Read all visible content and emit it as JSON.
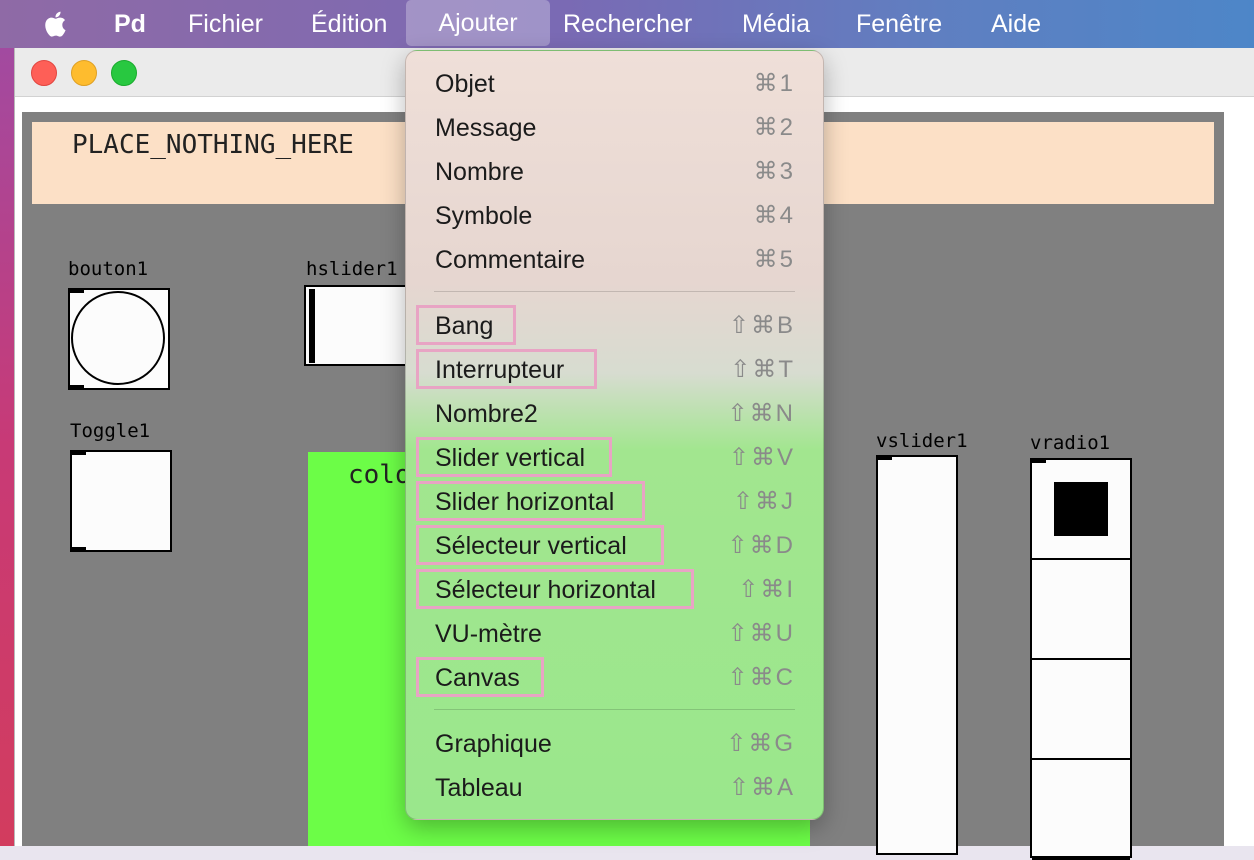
{
  "menubar": {
    "app": "Pd",
    "items": [
      "Fichier",
      "Édition",
      "Ajouter",
      "Rechercher",
      "Média",
      "Fenêtre",
      "Aide"
    ],
    "active": "Ajouter"
  },
  "patch": {
    "banner_text": "PLACE_NOTHING_HERE",
    "labels": {
      "bouton1": "bouton1",
      "hslider1": "hslider1",
      "toggle1": "Toggle1",
      "vslider1": "vslider1",
      "vradio1": "vradio1",
      "canvas_partial": "colo"
    },
    "vradio_selected_index": 0
  },
  "menu": {
    "group1": [
      {
        "label": "Objet",
        "shortcut": "⌘1"
      },
      {
        "label": "Message",
        "shortcut": "⌘2"
      },
      {
        "label": "Nombre",
        "shortcut": "⌘3"
      },
      {
        "label": "Symbole",
        "shortcut": "⌘4"
      },
      {
        "label": "Commentaire",
        "shortcut": "⌘5"
      }
    ],
    "group2": [
      {
        "label": "Bang",
        "shortcut": "⇧⌘B"
      },
      {
        "label": "Interrupteur",
        "shortcut": "⇧⌘T"
      },
      {
        "label": "Nombre2",
        "shortcut": "⇧⌘N"
      },
      {
        "label": "Slider vertical",
        "shortcut": "⇧⌘V"
      },
      {
        "label": "Slider horizontal",
        "shortcut": "⇧⌘J"
      },
      {
        "label": "Sélecteur vertical",
        "shortcut": "⇧⌘D"
      },
      {
        "label": "Sélecteur horizontal",
        "shortcut": "⇧⌘I"
      },
      {
        "label": "VU-mètre",
        "shortcut": "⇧⌘U"
      },
      {
        "label": "Canvas",
        "shortcut": "⇧⌘C"
      }
    ],
    "group3": [
      {
        "label": "Graphique",
        "shortcut": "⇧⌘G"
      },
      {
        "label": "Tableau",
        "shortcut": "⇧⌘A"
      }
    ]
  },
  "colors": {
    "highlight": "#e8a4c4",
    "canvas_green": "#6cfd47",
    "banner": "#fce0c6",
    "patch_bg": "#808080"
  }
}
